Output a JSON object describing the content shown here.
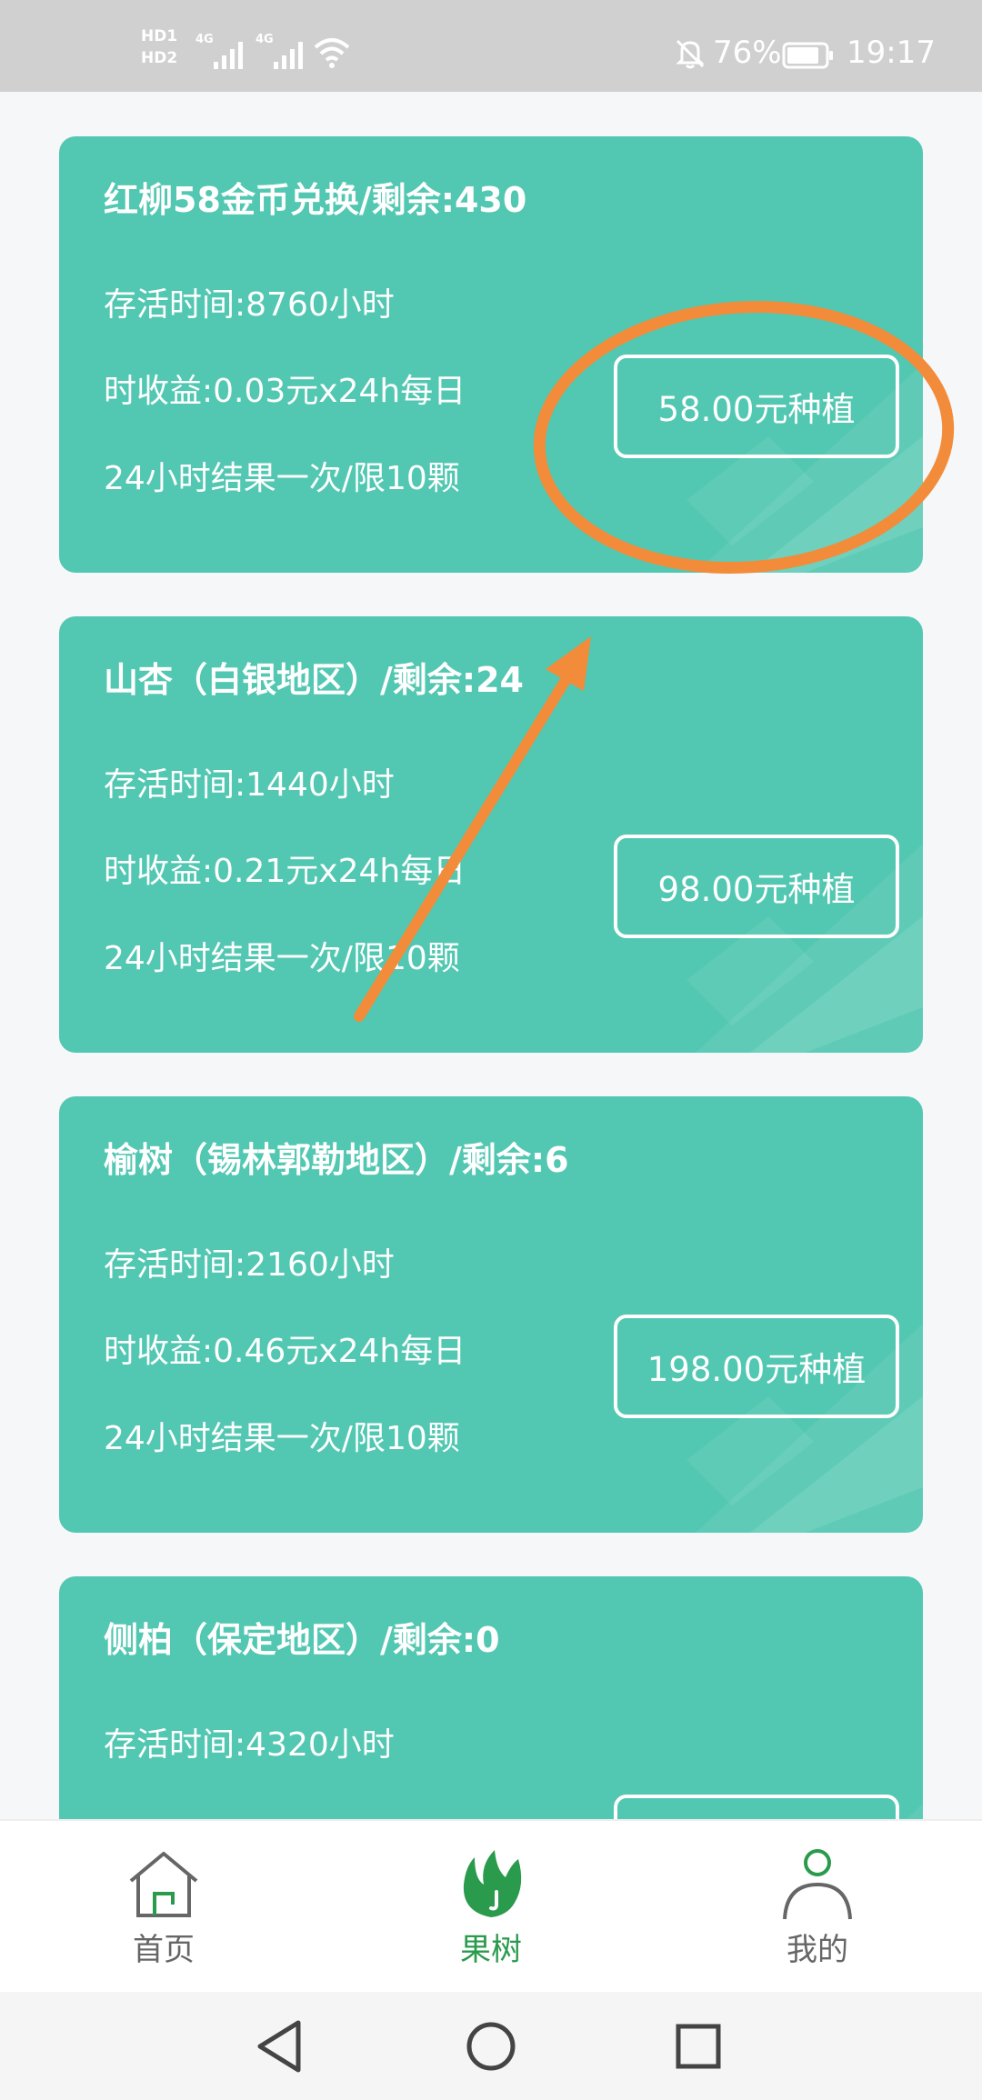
{
  "status_bar": {
    "sim1": "HD1",
    "sim2": "HD2",
    "net1": "4G",
    "net2": "4G",
    "battery_pct": "76%",
    "time": "19:17",
    "icons": [
      "signal-icon",
      "wifi-icon",
      "mute-bell-icon",
      "battery-icon"
    ]
  },
  "cards": [
    {
      "title": "红柳58金币兑换/剩余:430",
      "survival": "存活时间:8760小时",
      "income": "时收益:0.03元x24h每日",
      "fruit": "24小时结果一次/限10颗",
      "button": "58.00元种植"
    },
    {
      "title": "山杏（白银地区）/剩余:24",
      "survival": "存活时间:1440小时",
      "income": "时收益:0.21元x24h每日",
      "fruit": "24小时结果一次/限10颗",
      "button": "98.00元种植"
    },
    {
      "title": "榆树（锡林郭勒地区）/剩余:6",
      "survival": "存活时间:2160小时",
      "income": "时收益:0.46元x24h每日",
      "fruit": "24小时结果一次/限10颗",
      "button": "198.00元种植"
    },
    {
      "title": "侧柏（保定地区）/剩余:0",
      "survival": "存活时间:4320小时",
      "income": "",
      "fruit": "",
      "button": ""
    }
  ],
  "bottom_nav": {
    "items": [
      {
        "label": "首页",
        "icon": "home-icon",
        "active": false
      },
      {
        "label": "果树",
        "icon": "leaf-icon",
        "active": true
      },
      {
        "label": "我的",
        "icon": "person-icon",
        "active": false
      }
    ]
  },
  "system_nav": {
    "icons": [
      "back-triangle-icon",
      "home-circle-icon",
      "recents-square-icon"
    ]
  },
  "colors": {
    "card_bg": "#52c7b1",
    "annotation": "#f28c3a",
    "nav_active": "#2a9a4c",
    "status_bar_bg": "#d0d0d0"
  }
}
